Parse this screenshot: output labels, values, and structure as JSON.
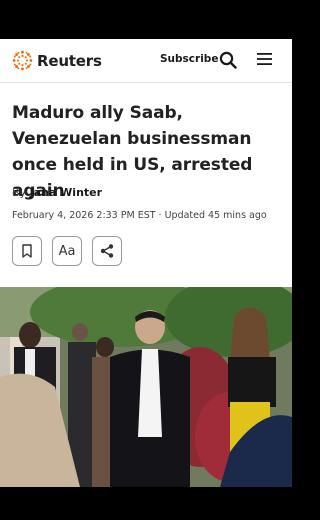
{
  "header": {
    "brand": "Reuters",
    "subscribe_label": "Subscribe",
    "brand_color": "#fa6400"
  },
  "article": {
    "headline": "Maduro ally Saab, Venezuelan businessman once held in US, arrested again",
    "byline_prefix": "By",
    "author": "Jana Winter",
    "dateline": "February 4, 2026 2:33 PM EST · Updated 45 mins ago",
    "text_size_label": "Aa"
  },
  "icons": {
    "search": "search-icon",
    "menu": "hamburger-menu-icon",
    "bookmark": "bookmark-icon",
    "share": "share-icon"
  }
}
